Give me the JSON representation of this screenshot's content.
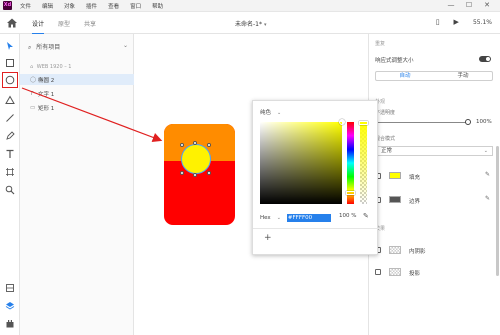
{
  "app": {
    "logo_text": "Xd"
  },
  "menu": [
    "文件",
    "编辑",
    "对象",
    "插件",
    "查看",
    "窗口",
    "帮助"
  ],
  "window_controls": {
    "minimize": "—",
    "maximize": "☐",
    "close": "✕"
  },
  "toolbar": {
    "tabs": [
      {
        "label": "设计",
        "active": true
      },
      {
        "label": "原型",
        "active": false
      },
      {
        "label": "共享",
        "active": false
      }
    ],
    "doc_title": "未命名-1",
    "doc_title_suffix": "*",
    "zoom": "55.1%"
  },
  "layers": {
    "search_label": "所有项目",
    "artboard_title": "WEB 1920 – 1",
    "items": [
      {
        "icon": "◯",
        "label": "椭圆 2",
        "active": true
      },
      {
        "icon": "T",
        "label": "文字 1",
        "active": false
      },
      {
        "icon": "▭",
        "label": "矩形 1",
        "active": false
      }
    ]
  },
  "picker": {
    "mode": "纯色",
    "hex_label": "Hex",
    "hex_value": "#FFFF00",
    "opacity": "100 %",
    "add_label": "+"
  },
  "props": {
    "repeat_grid_header": "重复",
    "responsive_label": "响应式调整大小",
    "responsive_on": true,
    "seg": [
      {
        "label": "自动",
        "on": true
      },
      {
        "label": "手动",
        "on": false
      }
    ],
    "appearance_header": "外观",
    "opacity_label": "不透明度",
    "opacity_value": "100%",
    "blend_header": "混合模式",
    "blend_value": "正常",
    "fill_label": "填充",
    "fill_color": "#ffff00",
    "border_label": "边界",
    "border_color": "#555555",
    "effects_header": "效果",
    "inner_shadow_label": "内阴影",
    "shadow_label": "投影"
  },
  "colors": {
    "artboard_bottom": "#ff0000",
    "artboard_top": "#ff8c00",
    "circle": "#fff200",
    "accent": "#2680eb",
    "annotation": "#e02020"
  }
}
